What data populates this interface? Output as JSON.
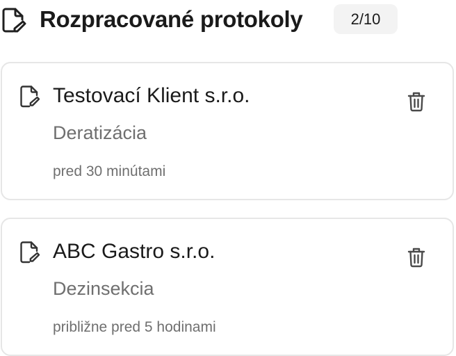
{
  "header": {
    "title": "Rozpracované protokoly",
    "count": "2/10",
    "icon": "document-edit-icon"
  },
  "protocols": [
    {
      "client": "Testovací Klient s.r.o.",
      "service": "Deratizácia",
      "time": "pred 30 minútami",
      "icon": "document-edit-icon",
      "delete_icon": "trash-icon"
    },
    {
      "client": "ABC Gastro s.r.o.",
      "service": "Dezinsekcia",
      "time": "približne pred 5 hodinami",
      "icon": "document-edit-icon",
      "delete_icon": "trash-icon"
    }
  ],
  "colors": {
    "text_primary": "#1a1a1a",
    "text_secondary": "#6f6f6f",
    "card_border": "#e6e6e6",
    "badge_background": "#f3f3f3"
  }
}
